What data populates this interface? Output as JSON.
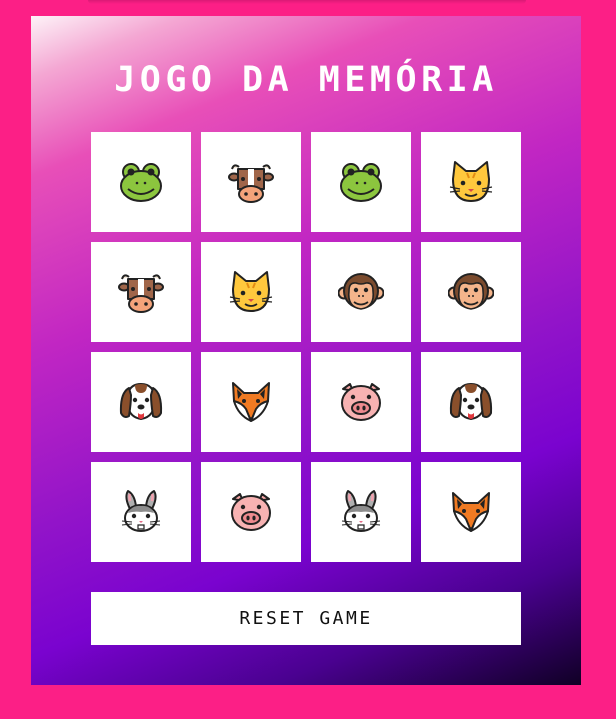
{
  "title": "JOGO DA MEMÓRIA",
  "reset_label": "RESET GAME",
  "colors": {
    "page_bg": "#fc1f86",
    "card_bg": "#ffffff",
    "title": "#ffffff"
  },
  "cards": [
    {
      "animal": "frog",
      "icon": "frog-face-icon"
    },
    {
      "animal": "cow",
      "icon": "cow-face-icon"
    },
    {
      "animal": "frog",
      "icon": "frog-face-icon"
    },
    {
      "animal": "cat",
      "icon": "cat-face-icon"
    },
    {
      "animal": "cow",
      "icon": "cow-face-icon"
    },
    {
      "animal": "cat",
      "icon": "cat-face-icon"
    },
    {
      "animal": "monkey",
      "icon": "monkey-face-icon"
    },
    {
      "animal": "monkey",
      "icon": "monkey-face-icon"
    },
    {
      "animal": "dog",
      "icon": "dog-face-icon"
    },
    {
      "animal": "fox",
      "icon": "fox-face-icon"
    },
    {
      "animal": "pig",
      "icon": "pig-face-icon"
    },
    {
      "animal": "dog",
      "icon": "dog-face-icon"
    },
    {
      "animal": "rabbit",
      "icon": "rabbit-face-icon"
    },
    {
      "animal": "pig",
      "icon": "pig-face-icon"
    },
    {
      "animal": "rabbit",
      "icon": "rabbit-face-icon"
    },
    {
      "animal": "fox",
      "icon": "fox-face-icon"
    }
  ]
}
